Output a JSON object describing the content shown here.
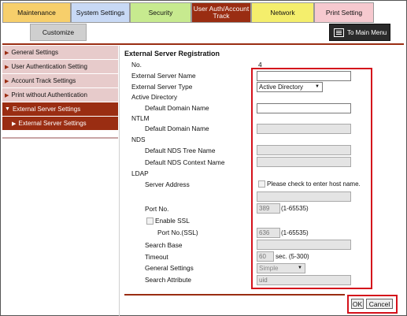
{
  "tabs": [
    {
      "label": "Maintenance",
      "bg": "#f7cf6b"
    },
    {
      "label": "System Settings",
      "bg": "#c8d9f5"
    },
    {
      "label": "Security",
      "bg": "#c7ea8f"
    },
    {
      "label": "User Auth/Account Track",
      "bg": "#9a2d12"
    },
    {
      "label": "Network",
      "bg": "#f4ee6c"
    },
    {
      "label": "Print Setting",
      "bg": "#f6c9cf"
    }
  ],
  "customize": "Customize",
  "main_menu": "To Main Menu",
  "sidebar": [
    {
      "label": "General Settings"
    },
    {
      "label": "User Authentication Setting"
    },
    {
      "label": "Account Track Settings"
    },
    {
      "label": "Print without Authentication"
    },
    {
      "label": "External Server Settings"
    },
    {
      "label": "External Server Settings"
    }
  ],
  "form": {
    "title": "External Server Registration",
    "no_label": "No.",
    "no_value": "4",
    "name_label": "External Server Name",
    "name_value": "",
    "type_label": "External Server Type",
    "type_value": "Active Directory",
    "ad_section": "Active Directory",
    "ad_domain_label": "Default Domain Name",
    "ntlm_section": "NTLM",
    "ntlm_domain_label": "Default Domain Name",
    "nds_section": "NDS",
    "nds_tree_label": "Default NDS Tree Name",
    "nds_context_label": "Default NDS Context Name",
    "ldap_section": "LDAP",
    "server_address_label": "Server Address",
    "host_check_label": "Please check to enter host name.",
    "port_label": "Port No.",
    "port_value": "389",
    "port_range": "(1-65535)",
    "ssl_label": "Enable SSL",
    "ssl_port_label": "Port No.(SSL)",
    "ssl_port_value": "636",
    "ssl_port_range": "(1-65535)",
    "search_base_label": "Search Base",
    "timeout_label": "Timeout",
    "timeout_value": "60",
    "timeout_unit": "sec. (5-300)",
    "general_settings_label": "General Settings",
    "general_settings_value": "Simple",
    "search_attr_label": "Search Attribute",
    "search_attr_value": "uid"
  },
  "buttons": {
    "ok": "OK",
    "cancel": "Cancel"
  }
}
